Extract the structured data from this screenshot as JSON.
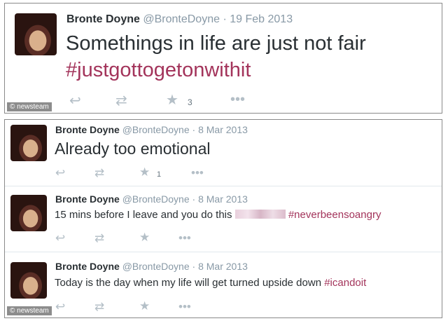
{
  "watermark": "© newsteam",
  "tweets": [
    {
      "name": "Bronte Doyne",
      "handle": "@BronteDoyne",
      "separator": "·",
      "date": "19 Feb 2013",
      "text": "Somethings in life are just not fair",
      "hashtag": "#justgottogetonwithit",
      "favorites": "3"
    },
    {
      "name": "Bronte Doyne",
      "handle": "@BronteDoyne",
      "separator": "·",
      "date": "8 Mar 2013",
      "text": "Already too emotional",
      "favorites": "1"
    },
    {
      "name": "Bronte Doyne",
      "handle": "@BronteDoyne",
      "separator": "·",
      "date": "8 Mar 2013",
      "text": "15 mins before I leave and you do this",
      "hashtag": "#neverbeensoangry"
    },
    {
      "name": "Bronte Doyne",
      "handle": "@BronteDoyne",
      "separator": "·",
      "date": "8 Mar 2013",
      "text": "Today is the day when my life will get turned upside down",
      "hashtag": "#icandoit"
    }
  ],
  "icons": {
    "reply": "reply-icon",
    "retweet": "retweet-icon",
    "favorite": "star-icon",
    "more": "more-icon"
  },
  "colors": {
    "name": "#292f33",
    "meta": "#8899a6",
    "hashtag": "#a3345b",
    "action": "#b4bfc7",
    "border": "#8a8a8a"
  }
}
